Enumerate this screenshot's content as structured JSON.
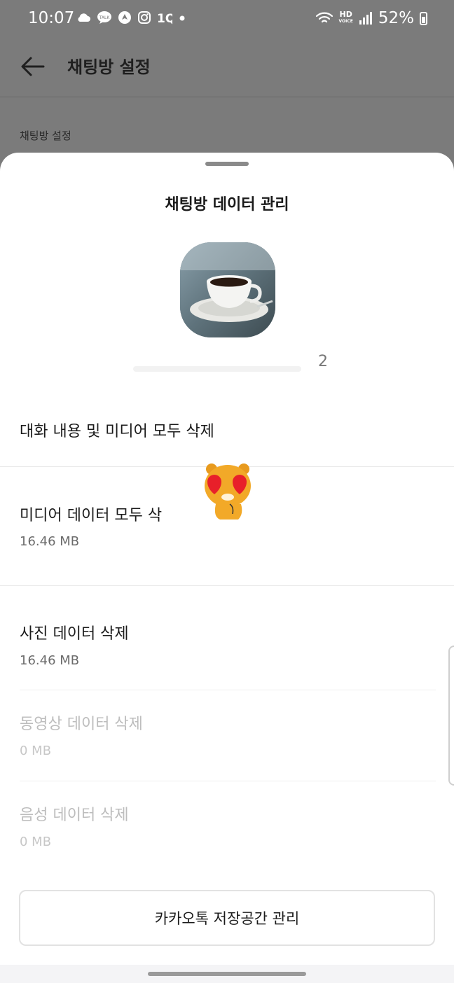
{
  "status_bar": {
    "time": "10:07",
    "left_icons": [
      "cloud-icon",
      "talk-icon",
      "navigation-icon",
      "instagram-icon",
      "app-icon"
    ],
    "network": "HD",
    "network_sub": "VOICE",
    "battery": "52%"
  },
  "appbar": {
    "title": "채팅방 설정"
  },
  "background": {
    "section_label": "채팅방 설정"
  },
  "sheet": {
    "title": "채팅방 데이터 관리",
    "chat_name": "2",
    "rows": [
      {
        "title": "대화 내용 및 미디어 모두 삭제",
        "subtitle": ""
      },
      {
        "title": "미디어 데이터 모두 삭",
        "subtitle": "16.46 MB"
      },
      {
        "title": "사진 데이터 삭제",
        "subtitle": "16.46 MB"
      },
      {
        "title": "동영상 데이터 삭제",
        "subtitle": "0 MB",
        "disabled": true
      },
      {
        "title": "음성 데이터 삭제",
        "subtitle": "0 MB",
        "disabled": true
      }
    ],
    "storage_button": "카카오톡 저장공간 관리"
  },
  "colors": {
    "scrim": "#7b7b7b",
    "sheet_bg": "#ffffff",
    "disabled_text": "#bdbdbd"
  }
}
